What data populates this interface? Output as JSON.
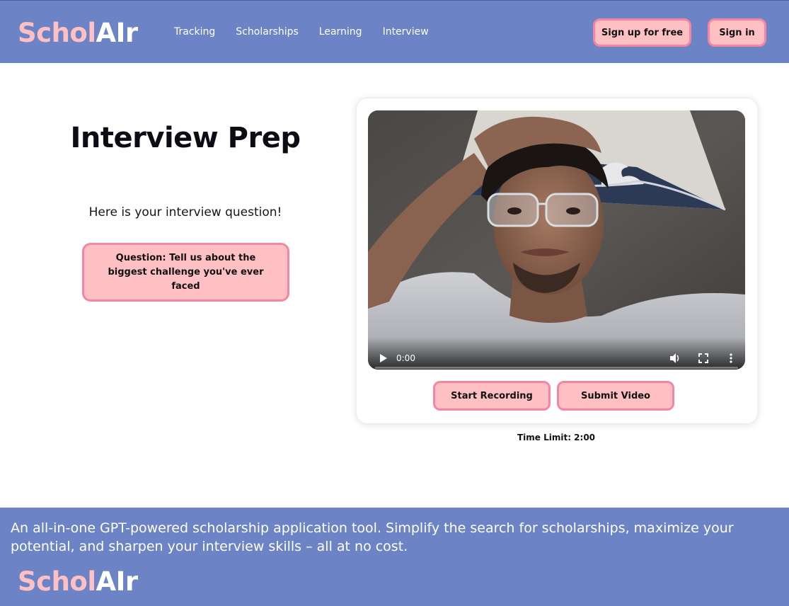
{
  "brand": {
    "part1": "Schol",
    "part2": "AIr",
    "color_pink": "#ffc0c3",
    "color_white": "#ffffff"
  },
  "nav": {
    "items": [
      "Tracking",
      "Scholarships",
      "Learning",
      "Interview"
    ],
    "signup_label": "Sign up for free",
    "signin_label": "Sign in"
  },
  "page": {
    "title": "Interview Prep",
    "subtitle": "Here is your interview question!",
    "question": "Question: Tell us about the biggest challenge you've ever faced"
  },
  "video": {
    "time": "0:00",
    "play_icon": "play-icon",
    "volume_icon": "volume-icon",
    "fullscreen_icon": "fullscreen-icon",
    "more_icon": "more-options-icon",
    "progress": 0
  },
  "actions": {
    "record_label": "Start Recording",
    "submit_label": "Submit Video"
  },
  "time_limit": "Time Limit: 2:00",
  "footer": {
    "tagline": "An all-in-one GPT-powered scholarship application tool. Simplify the search for scholarships, maximize your potential, and sharpen your interview skills – all at no cost."
  },
  "colors": {
    "header_bg": "#6c84c6",
    "button_bg": "#ffc0c3",
    "button_border": "#f685a3"
  }
}
